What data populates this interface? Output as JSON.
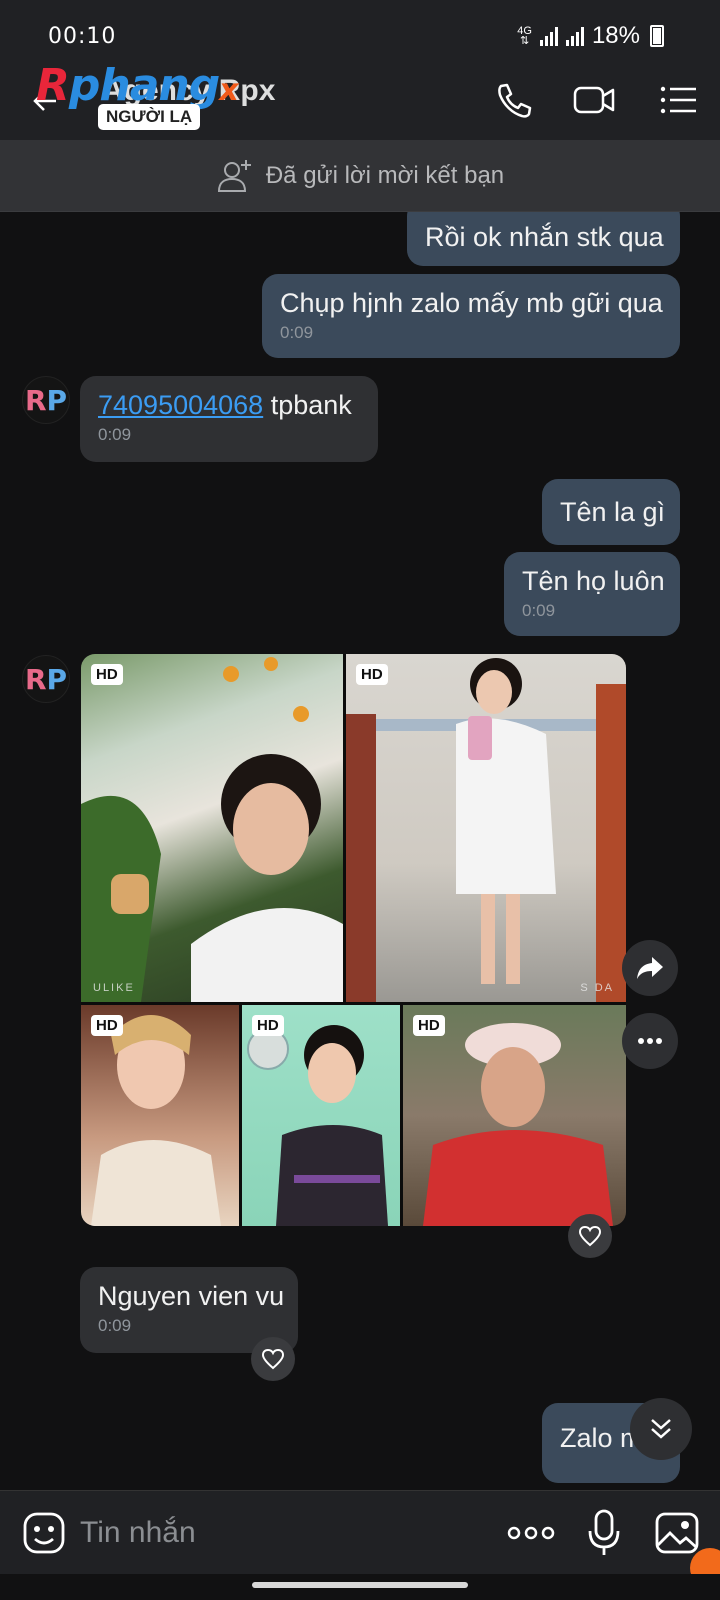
{
  "status": {
    "time": "00:10",
    "network": "4G",
    "battery": "18%"
  },
  "header": {
    "watermark_main": "Rphang",
    "watermark_x": "x",
    "contact_name": "Agency Rpx",
    "stranger_badge": "NGƯỜI LẠ",
    "icons": [
      "back-arrow-icon",
      "phone-icon",
      "video-camera-icon",
      "list-menu-icon"
    ]
  },
  "friend_request": {
    "text": "Đã gửi lời mời kết bạn",
    "icon": "add-user-icon"
  },
  "messages": [
    {
      "direction": "outgoing",
      "text": "Rồi ok nhắn stk qua"
    },
    {
      "direction": "outgoing",
      "text": "Chụp hjnh zalo mấy mb gữi qua",
      "time": "0:09"
    },
    {
      "direction": "incoming",
      "account_number": "74095004068",
      "text": " tpbank",
      "time": "0:09"
    },
    {
      "direction": "outgoing",
      "text": "Tên la gì"
    },
    {
      "direction": "outgoing",
      "text": "Tên họ luôn",
      "time": "0:09"
    },
    {
      "direction": "incoming",
      "type": "photo-album",
      "photo_count": 5,
      "hd_label": "HD",
      "photo_captions": [
        "ULIKE",
        "S DA"
      ]
    },
    {
      "direction": "incoming",
      "text": "Nguyen vien vu",
      "time": "0:09"
    },
    {
      "direction": "outgoing",
      "text": "Zalo mb"
    }
  ],
  "avatar": {
    "initial_1": "R",
    "initial_2": "P"
  },
  "input": {
    "placeholder": "Tin nhắn"
  },
  "colors": {
    "outgoing_bubble": "#3b4a5b",
    "incoming_bubble": "#2f3033",
    "link": "#3b9cf3",
    "background": "#111112"
  }
}
